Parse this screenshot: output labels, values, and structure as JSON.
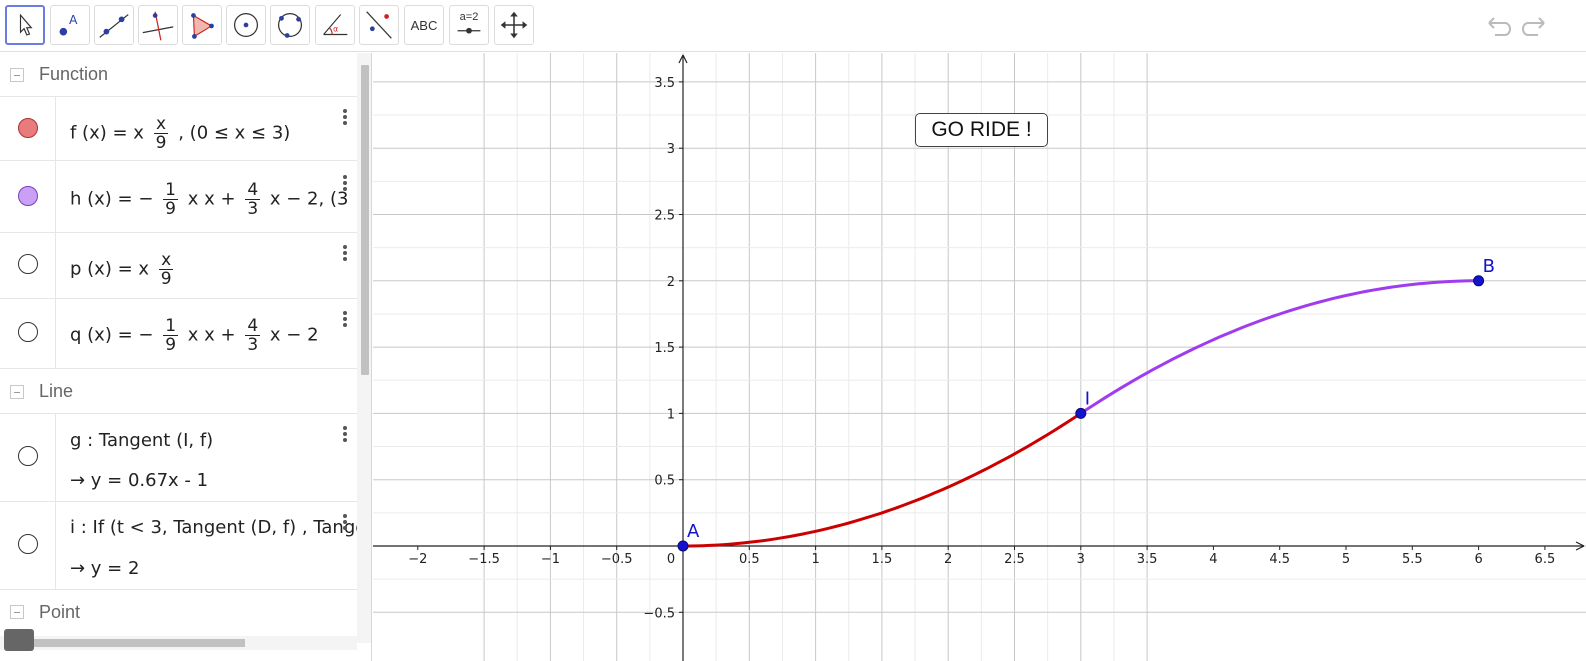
{
  "toolbar": {
    "tools": [
      {
        "name": "move-tool",
        "icon": "cursor-arrow-icon",
        "active": true
      },
      {
        "name": "point-tool",
        "icon": "point-a-icon"
      },
      {
        "name": "line-tool",
        "icon": "line-through-points-icon"
      },
      {
        "name": "perpendicular-line-tool",
        "icon": "perpendicular-line-icon"
      },
      {
        "name": "polygon-tool",
        "icon": "polygon-icon"
      },
      {
        "name": "circle-center-point-tool",
        "icon": "circle-center-icon"
      },
      {
        "name": "circle-three-points-tool",
        "icon": "circle-three-points-icon"
      },
      {
        "name": "angle-tool",
        "icon": "angle-icon"
      },
      {
        "name": "reflect-tool",
        "icon": "reflect-about-line-icon"
      },
      {
        "name": "text-tool",
        "label": "ABC"
      },
      {
        "name": "slider-tool",
        "label": "a=2"
      },
      {
        "name": "move-graphics-tool",
        "icon": "move-graphics-icon"
      }
    ],
    "undo_icon": "undo-icon",
    "redo_icon": "redo-icon"
  },
  "algebra": {
    "groups": {
      "function": "Function",
      "line": "Line",
      "point": "Point"
    },
    "functions": {
      "f": {
        "lhs": "f (x)  =  x",
        "frac_num": "x",
        "frac_den": "9",
        "rest": ",     (0 ≤ x ≤ 3)",
        "color": "#e87c7c",
        "visible": true
      },
      "h": {
        "lhs": "h (x)  =  −",
        "frac1_num": "1",
        "frac1_den": "9",
        "mid": "x x +",
        "frac2_num": "4",
        "frac2_den": "3",
        "rest": "x − 2,     (3",
        "color": "#c9a0f5",
        "visible": true
      },
      "p": {
        "lhs": "p (x)  =  x",
        "frac_num": "x",
        "frac_den": "9",
        "visible": false
      },
      "q": {
        "lhs": "q (x)  =  −",
        "frac1_num": "1",
        "frac1_den": "9",
        "mid": "x x +",
        "frac2_num": "4",
        "frac2_den": "3",
        "rest": "x − 2",
        "visible": false
      }
    },
    "lines": {
      "g": {
        "def": "g : Tangent (I, f)",
        "value": "→  y  =  0.67x - 1"
      },
      "i": {
        "def": "i : If (t < 3, Tangent (D, f) , Tange",
        "value": "→  y  =  2"
      }
    }
  },
  "graphics": {
    "button_label": "GO RIDE !",
    "x_ticks": [
      "−2",
      "−1.5",
      "−1",
      "−0.5",
      "0",
      "0.5",
      "1",
      "1.5",
      "2",
      "2.5",
      "3",
      "3.5",
      "4",
      "4.5",
      "5",
      "5.5",
      "6",
      "6.5"
    ],
    "y_ticks": [
      "3.5",
      "3",
      "2.5",
      "2",
      "1.5",
      "1",
      "0.5",
      "−0.5"
    ],
    "points": [
      {
        "label": "A",
        "x": 0,
        "y": 0
      },
      {
        "label": "I",
        "x": 3,
        "y": 1
      },
      {
        "label": "B",
        "x": 6,
        "y": 2
      }
    ],
    "curve_colors": {
      "f": "#cc0000",
      "h": "#a03cf0"
    },
    "point_color": "#1212d0"
  }
}
